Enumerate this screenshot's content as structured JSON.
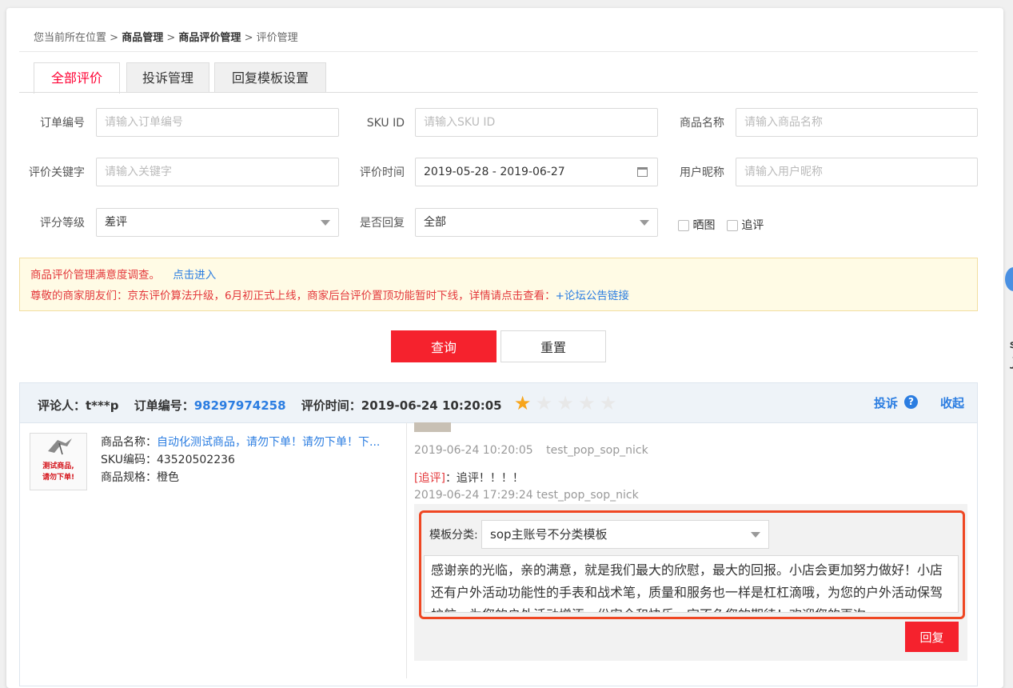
{
  "breadcrumb": {
    "prefix": "您当前所在位置",
    "sep": ">",
    "level1": "商品管理",
    "level2": "商品评价管理",
    "level3": "评价管理"
  },
  "tabs": [
    {
      "label": "全部评价",
      "active": true
    },
    {
      "label": "投诉管理",
      "active": false
    },
    {
      "label": "回复模板设置",
      "active": false
    }
  ],
  "filters": {
    "order_no": {
      "label": "订单编号",
      "placeholder": "请输入订单编号"
    },
    "sku_id": {
      "label": "SKU ID",
      "placeholder": "请输入SKU ID"
    },
    "product_name": {
      "label": "商品名称",
      "placeholder": "请输入商品名称"
    },
    "keyword": {
      "label": "评价关键字",
      "placeholder": "请输入关键字"
    },
    "review_time": {
      "label": "评价时间",
      "value": "2019-05-28 - 2019-06-27"
    },
    "nickname": {
      "label": "用户昵称",
      "placeholder": "请输入用户昵称"
    },
    "rating": {
      "label": "评分等级",
      "value": "差评"
    },
    "replied": {
      "label": "是否回复",
      "value": "全部"
    },
    "show_pic": {
      "label": "晒图"
    },
    "followup": {
      "label": "追评"
    }
  },
  "notice": {
    "line1_text": "商品评价管理满意度调查。",
    "line1_link": "点击进入",
    "line2_text": "尊敬的商家朋友们：京东评价算法升级，6月初正式上线，商家后台评价置顶功能暂时下线，详情请点击查看：",
    "line2_link": "+论坛公告链接"
  },
  "actions": {
    "search": "查询",
    "reset": "重置"
  },
  "review": {
    "reviewer_label": "评论人：",
    "reviewer": "t***p",
    "order_label": "订单编号：",
    "order_no": "98297974258",
    "time_label": "评价时间：",
    "time": "2019-06-24 10:20:05",
    "rating": 1,
    "stars": [
      "★",
      "★",
      "★",
      "★",
      "★"
    ],
    "complain": "投诉",
    "help": "?",
    "collapse": "收起",
    "thumb_text_1": "测试商品,",
    "thumb_text_2": "请勿下单!",
    "product_label": "商品名称：",
    "product_name": "自动化测试商品，请勿下单！请勿下单！下...",
    "sku_label": "SKU编码：",
    "sku": "43520502236",
    "spec_label": "商品规格：",
    "spec": "橙色",
    "content_time": "2019-06-24 10:20:05",
    "content_nick": "test_pop_sop_nick",
    "followup_tag": "[追评]",
    "followup_text": "：追评！！！！",
    "followup_time": "2019-06-24 17:29:24",
    "followup_nick": "test_pop_sop_nick"
  },
  "reply": {
    "template_label": "模板分类:",
    "template_value": "sop主账号不分类模板",
    "text": "感谢亲的光临，亲的满意，就是我们最大的欣慰，最大的回报。小店会更加努力做好！小店还有户外活动功能性的手表和战术笔，质量和服务也一样是杠杠滴哦，为您的户外活动保驾护航，为您的户外活动增添一份安全和快乐，定不负您的期待！欢迎您的再次",
    "button": "回复"
  },
  "colors": {
    "accent": "#f5222d",
    "link": "#2b7de1",
    "highlight": "#ef4723",
    "star": "#f7a51c"
  }
}
